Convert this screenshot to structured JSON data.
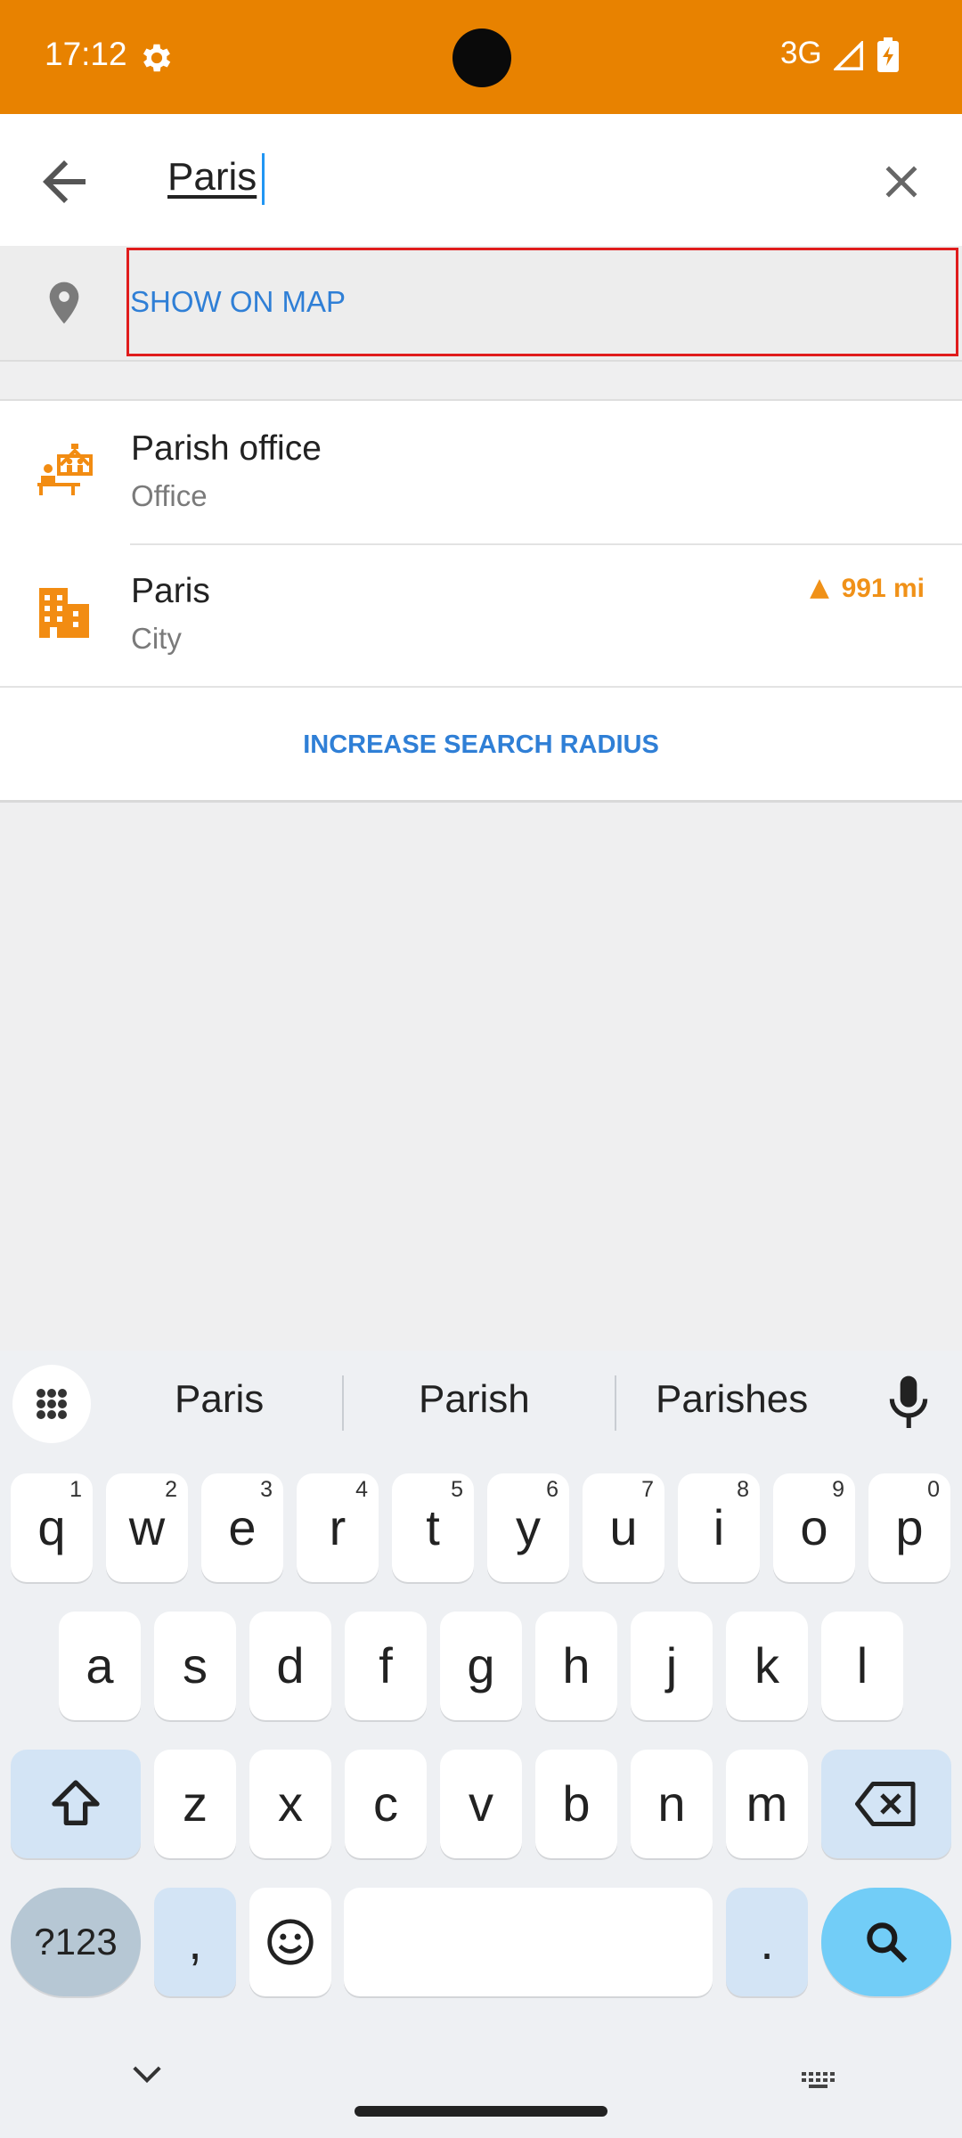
{
  "status_bar": {
    "time": "17:12",
    "network": "3G",
    "bg_color": "#e88200"
  },
  "search": {
    "query": "Paris"
  },
  "show_on_map": {
    "label": "SHOW ON MAP"
  },
  "results": [
    {
      "title": "Parish office",
      "subtitle": "Office",
      "icon": "office-icon",
      "distance": ""
    },
    {
      "title": "Paris",
      "subtitle": "City",
      "icon": "city-icon",
      "distance": "991 mi"
    }
  ],
  "increase_radius": {
    "label": "INCREASE SEARCH RADIUS"
  },
  "keyboard": {
    "suggestions": [
      "Paris",
      "Parish",
      "Parishes"
    ],
    "row1": [
      {
        "k": "q",
        "n": "1"
      },
      {
        "k": "w",
        "n": "2"
      },
      {
        "k": "e",
        "n": "3"
      },
      {
        "k": "r",
        "n": "4"
      },
      {
        "k": "t",
        "n": "5"
      },
      {
        "k": "y",
        "n": "6"
      },
      {
        "k": "u",
        "n": "7"
      },
      {
        "k": "i",
        "n": "8"
      },
      {
        "k": "o",
        "n": "9"
      },
      {
        "k": "p",
        "n": "0"
      }
    ],
    "row2": [
      "a",
      "s",
      "d",
      "f",
      "g",
      "h",
      "j",
      "k",
      "l"
    ],
    "row3": [
      "z",
      "x",
      "c",
      "v",
      "b",
      "n",
      "m"
    ],
    "symbols_label": "?123",
    "comma": ",",
    "period": "."
  }
}
